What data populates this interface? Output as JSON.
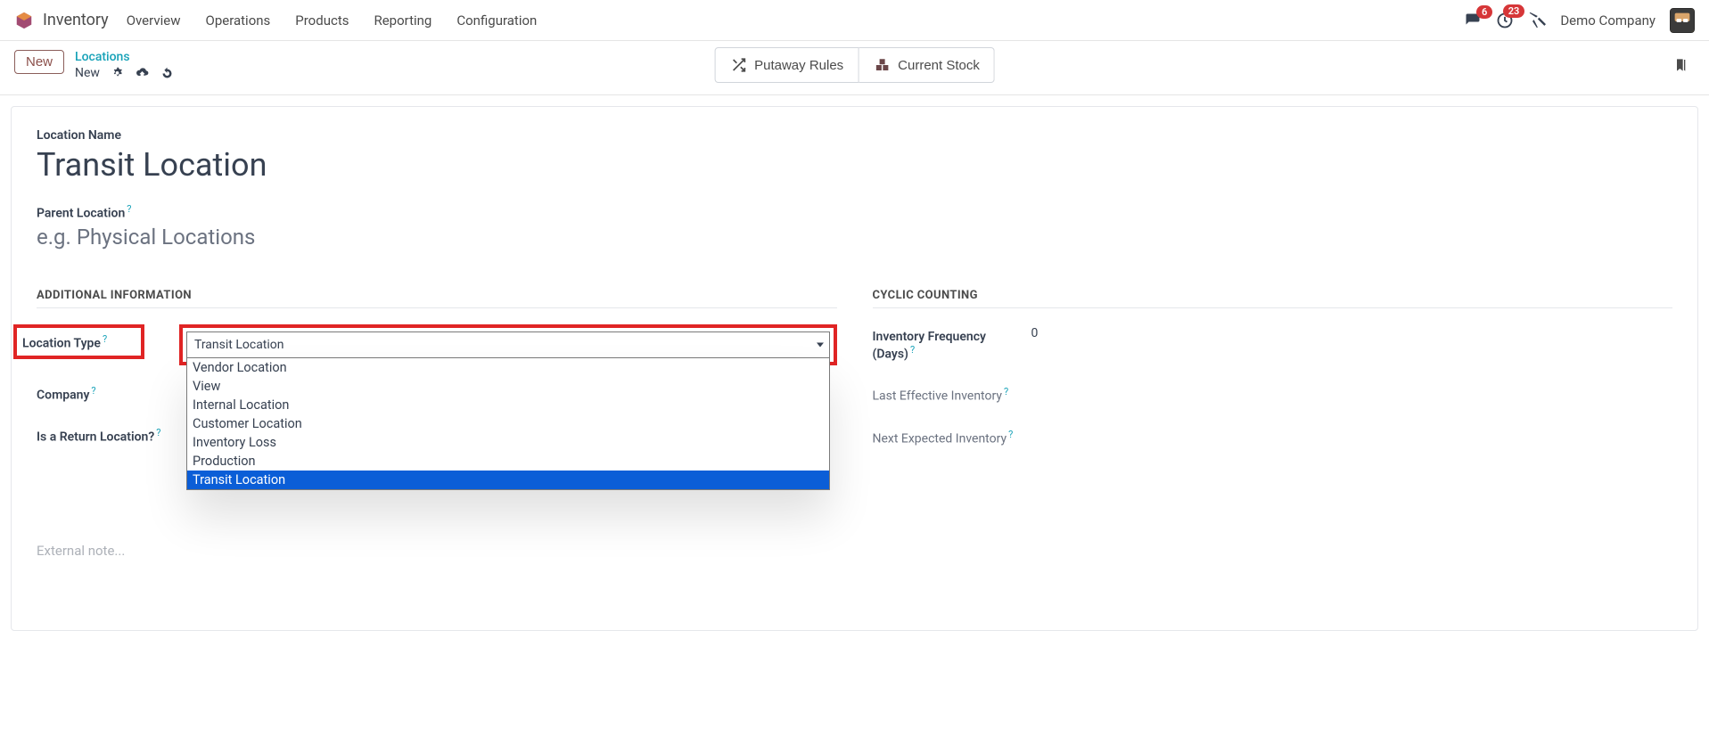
{
  "navbar": {
    "app_title": "Inventory",
    "menu": [
      "Overview",
      "Operations",
      "Products",
      "Reporting",
      "Configuration"
    ],
    "discuss_badge": "6",
    "activity_badge": "23",
    "company": "Demo Company"
  },
  "control_panel": {
    "new_btn": "New",
    "breadcrumb_link": "Locations",
    "breadcrumb_current": "New",
    "putaway_btn": "Putaway Rules",
    "stock_btn": "Current Stock"
  },
  "form": {
    "location_name_label": "Location Name",
    "location_name_value": "Transit Location",
    "parent_location_label": "Parent Location",
    "parent_location_placeholder": "e.g. Physical Locations",
    "left_section_title": "ADDITIONAL INFORMATION",
    "right_section_title": "CYCLIC COUNTING",
    "location_type_label": "Location Type",
    "location_type_selected": "Transit Location",
    "location_type_options": [
      "Vendor Location",
      "View",
      "Internal Location",
      "Customer Location",
      "Inventory Loss",
      "Production",
      "Transit Location"
    ],
    "company_label": "Company",
    "is_return_label": "Is a Return Location?",
    "inv_freq_label": "Inventory Frequency (Days)",
    "inv_freq_value": "0",
    "last_eff_label": "Last Effective Inventory",
    "next_exp_label": "Next Expected Inventory",
    "external_note_placeholder": "External note..."
  }
}
